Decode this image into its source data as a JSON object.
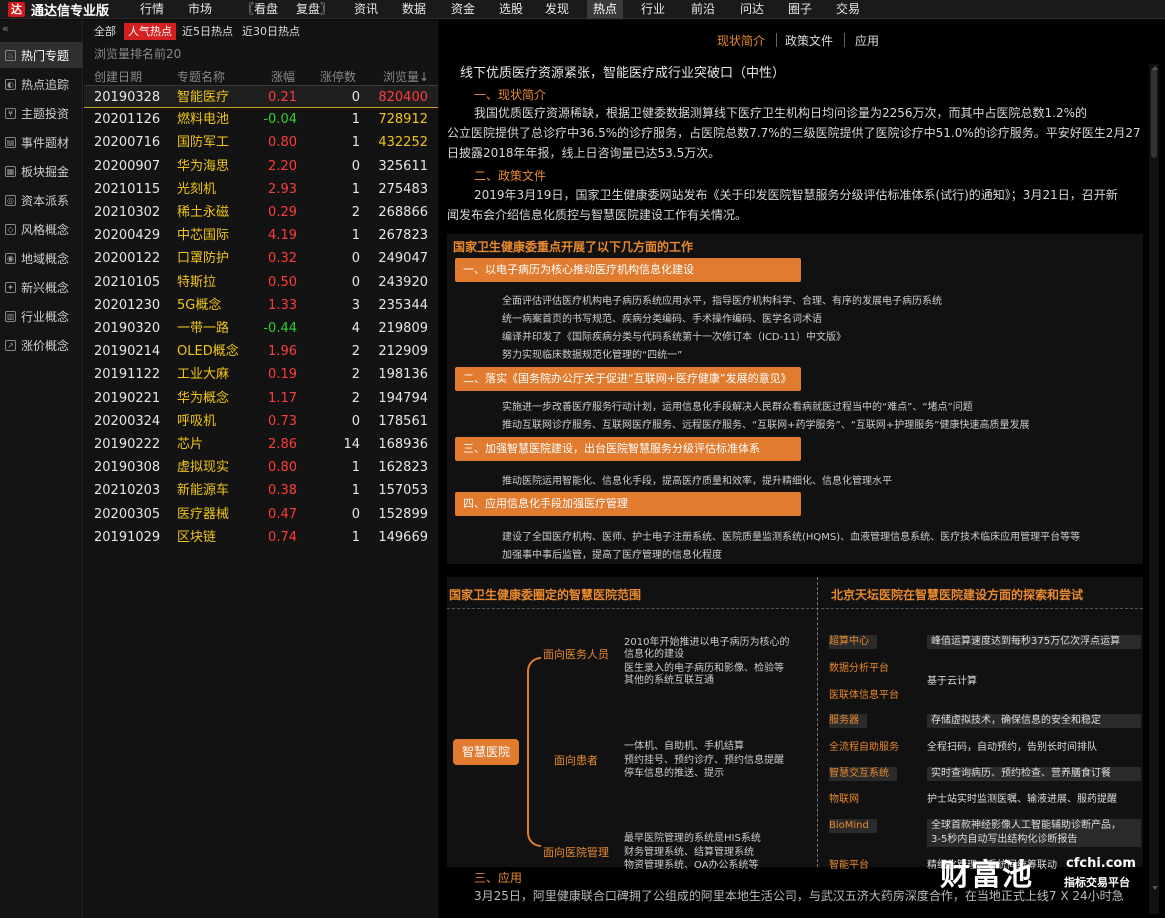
{
  "app": {
    "name": "通达信专业版",
    "logo_char": "达"
  },
  "menu": [
    "行情",
    "市场",
    "〖看盘",
    "复盘〗",
    "资讯",
    "数据",
    "资金",
    "选股",
    "发现",
    "热点",
    "行业",
    "前沿",
    "问达",
    "圈子",
    "交易"
  ],
  "menu_active": "热点",
  "sidebar": {
    "collapse": "«",
    "items": [
      "热门专题",
      "热点追踪",
      "主题投资",
      "事件题材",
      "板块掘金",
      "资本派系",
      "风格概念",
      "地域概念",
      "新兴概念",
      "行业概念",
      "涨价概念"
    ]
  },
  "filters": [
    "全部",
    "人气热点",
    "近5日热点",
    "近30日热点"
  ],
  "filter_active": "人气热点",
  "list_subtitle": "浏览量排名前20",
  "columns": [
    "创建日期",
    "专题名称",
    "涨幅",
    "涨停数",
    "浏览量↓"
  ],
  "rows": [
    {
      "date": "20190328",
      "name": "智能医疗",
      "pct": "0.21",
      "lim": "0",
      "vol": "820400",
      "pc": "red",
      "vc": "red"
    },
    {
      "date": "20201126",
      "name": "燃料电池",
      "pct": "-0.04",
      "lim": "1",
      "vol": "728912",
      "pc": "green",
      "vc": "yellow"
    },
    {
      "date": "20200716",
      "name": "国防军工",
      "pct": "0.80",
      "lim": "1",
      "vol": "432252",
      "pc": "red",
      "vc": "yellow"
    },
    {
      "date": "20200907",
      "name": "华为海思",
      "pct": "2.20",
      "lim": "0",
      "vol": "325611",
      "pc": "red",
      "vc": "white"
    },
    {
      "date": "20210115",
      "name": "光刻机",
      "pct": "2.93",
      "lim": "1",
      "vol": "275483",
      "pc": "red",
      "vc": "white"
    },
    {
      "date": "20210302",
      "name": "稀土永磁",
      "pct": "0.29",
      "lim": "2",
      "vol": "268866",
      "pc": "red",
      "vc": "white"
    },
    {
      "date": "20200429",
      "name": "中芯国际",
      "pct": "4.19",
      "lim": "1",
      "vol": "267823",
      "pc": "red",
      "vc": "white"
    },
    {
      "date": "20200122",
      "name": "口罩防护",
      "pct": "0.32",
      "lim": "0",
      "vol": "249047",
      "pc": "red",
      "vc": "white"
    },
    {
      "date": "20210105",
      "name": "特斯拉",
      "pct": "0.50",
      "lim": "0",
      "vol": "243920",
      "pc": "red",
      "vc": "white"
    },
    {
      "date": "20201230",
      "name": "5G概念",
      "pct": "1.33",
      "lim": "3",
      "vol": "235344",
      "pc": "red",
      "vc": "white"
    },
    {
      "date": "20190320",
      "name": "一带一路",
      "pct": "-0.44",
      "lim": "4",
      "vol": "219809",
      "pc": "green",
      "vc": "white"
    },
    {
      "date": "20190214",
      "name": "OLED概念",
      "pct": "1.96",
      "lim": "2",
      "vol": "212909",
      "pc": "red",
      "vc": "white"
    },
    {
      "date": "20191122",
      "name": "工业大麻",
      "pct": "0.19",
      "lim": "2",
      "vol": "198136",
      "pc": "red",
      "vc": "white"
    },
    {
      "date": "20190221",
      "name": "华为概念",
      "pct": "1.17",
      "lim": "2",
      "vol": "194794",
      "pc": "red",
      "vc": "white"
    },
    {
      "date": "20200324",
      "name": "呼吸机",
      "pct": "0.73",
      "lim": "0",
      "vol": "178561",
      "pc": "red",
      "vc": "white"
    },
    {
      "date": "20190222",
      "name": "芯片",
      "pct": "2.86",
      "lim": "14",
      "vol": "168936",
      "pc": "red",
      "vc": "white"
    },
    {
      "date": "20190308",
      "name": "虚拟现实",
      "pct": "0.80",
      "lim": "1",
      "vol": "162823",
      "pc": "red",
      "vc": "white"
    },
    {
      "date": "20210203",
      "name": "新能源车",
      "pct": "0.38",
      "lim": "1",
      "vol": "157053",
      "pc": "red",
      "vc": "white"
    },
    {
      "date": "20200305",
      "name": "医疗器械",
      "pct": "0.47",
      "lim": "0",
      "vol": "152899",
      "pc": "red",
      "vc": "white"
    },
    {
      "date": "20191029",
      "name": "区块链",
      "pct": "0.74",
      "lim": "1",
      "vol": "149669",
      "pc": "red",
      "vc": "white"
    }
  ],
  "content_tabs": [
    "现状简介",
    "政策文件",
    "应用"
  ],
  "content_tab_active": "现状简介",
  "article": {
    "headline": "线下优质医疗资源紧张，智能医疗成行业突破口（中性）",
    "sec1": "一、现状简介",
    "p1_l1": "我国优质医疗资源稀缺，根据卫健委数据测算线下医疗卫生机构日均问诊量为2256万次，而其中占医院总数1.2%的",
    "p1_l2": "公立医院提供了总诊疗中36.5%的诊疗服务，占医院总数7.7%的三级医院提供了医院诊疗中51.0%的诊疗服务。平安好医生2月27",
    "p1_l3": "日披露2018年年报，线上日咨询量已达53.5万次。",
    "sec2": "二、政策文件",
    "p2_l1": "2019年3月19日，国家卫生健康委网站发布《关于印发医院智慧服务分级评估标准体系(试行)的通知》；3月21日，召开新",
    "p2_l2": "闻发布会介绍信息化质控与智慧医院建设工作有关情况。",
    "sec3": "三、应用",
    "p3_l1": "3月25日，阿里健康联合口碑拥了公组成的阿里本地生活公司，与武汉五济大药房深度合作，在当地正式上线7 X 24小时急"
  },
  "infobox": {
    "title": "国家卫生健康委重点开展了以下几方面的工作",
    "bar1": "一、以电子病历为核心推动医疗机构信息化建设",
    "b1": [
      "全面评估评估医疗机构电子病历系统应用水平，指导医疗机构科学、合理、有序的发展电子病历系统",
      "统一病案首页的书写规范、疾病分类编码、手术操作编码、医学名词术语",
      "编译并印发了《国际疾病分类与代码系统第十一次修订本（ICD-11）中文版》",
      "努力实现临床数据规范化管理的“四统一”"
    ],
    "bar2": "二、落实《国务院办公厅关于促进“互联网+医疗健康”发展的意见》",
    "b2": [
      "实施进一步改善医疗服务行动计划，运用信息化手段解决人民群众看病就医过程当中的“难点”、“堵点”问题",
      "推动互联网诊疗服务、互联网医疗服务、远程医疗服务、“互联网+药学服务”、“互联网+护理服务”健康快速高质量发展"
    ],
    "bar3": "三、加强智慧医院建设，出台医院智慧服务分级评估标准体系",
    "b3": [
      "推动医院运用智能化、信息化手段，提高医疗质量和效率，提升精细化、信息化管理水平"
    ],
    "bar4": "四、应用信息化手段加强医疗管理",
    "b4": [
      "建设了全国医疗机构、医师、护士电子注册系统、医院质量监测系统(HQMS)、血液管理信息系统、医疗技术临床应用管理平台等等",
      "加强事中事后监管，提高了医疗管理的信息化程度"
    ]
  },
  "lower": {
    "left_title": "国家卫生健康委圈定的智慧医院范围",
    "right_title": "北京天坛医院在智慧医院建设方面的探索和尝试",
    "hub": "智慧医院",
    "branch1": "面向医务人员",
    "branch1_text": [
      "2010年开始推进以电子病历为核心的",
      "信息化的建设",
      "医生录入的电子病历和影像、检验等",
      "其他的系统互联互通"
    ],
    "branch2": "面向患者",
    "branch2_text": [
      "一体机、自助机、手机结算",
      "预约挂号、预约诊疗、预约信息提醒",
      "停车信息的推送、提示"
    ],
    "branch3": "面向医院管理",
    "branch3_text": [
      "最早医院管理的系统是HIS系统",
      "财务管理系统、结算管理系统",
      "物资管理系统、OA办公系统等"
    ],
    "right_rows": [
      {
        "k": "超算中心",
        "v": "峰值运算速度达到每秒375万亿次浮点运算",
        "dark": true
      },
      {
        "k": "数据分析平台",
        "v": "基于云计算",
        "dark": false
      },
      {
        "k": "医联体信息平台",
        "v": "",
        "dark": false
      },
      {
        "k": "服务器",
        "v": "存储虚拟技术，确保信息的安全和稳定",
        "dark": true
      },
      {
        "k": "全流程自助服务",
        "v": "全程扫码，自动预约，告别长时间排队",
        "dark": false
      },
      {
        "k": "智慧交互系统",
        "v": "实时查询病历、预约检查、营养膳食订餐",
        "dark": true
      },
      {
        "k": "物联网",
        "v": "护士站实时监测医嘱、输液进展、服药提醒",
        "dark": false
      },
      {
        "k": "BioMind",
        "v": "全球首款神经影像人工智能辅助诊断产品，",
        "dark": true
      },
      {
        "k": "",
        "v": "3-5秒内自动写出结构化诊断报告",
        "dark": true
      },
      {
        "k": "智能平台",
        "v": "精细化管理，系统间统筹联动",
        "dark": false
      }
    ]
  },
  "watermark": {
    "big": "财富池",
    "domain": "cfchi.com",
    "sub": "指标交易平台"
  },
  "colors": {
    "accent": "#e8892e",
    "up": "#ff3b3b",
    "down": "#33cc33",
    "name": "#f0c419",
    "tab_active": "#d42020"
  }
}
